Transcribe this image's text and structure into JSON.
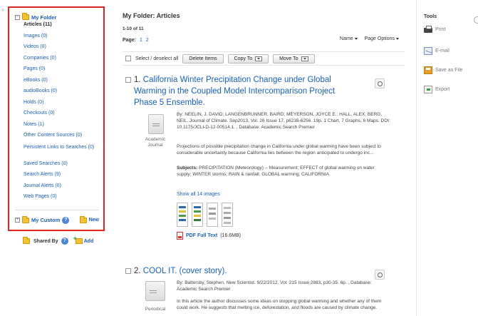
{
  "sidebar": {
    "folder_title": "My Folder",
    "items": [
      {
        "label": "Articles (11)",
        "active": true
      },
      {
        "label": "Images (0)"
      },
      {
        "label": "Videos (0)"
      },
      {
        "label": "Companies (0)"
      },
      {
        "label": "Pages (0)"
      },
      {
        "label": "eBooks (0)"
      },
      {
        "label": "audioBooks (0)"
      },
      {
        "label": "Holds (0)"
      },
      {
        "label": "Checkouts (0)"
      },
      {
        "label": "Notes (1)"
      },
      {
        "label": "Other Content Sources (0)"
      },
      {
        "label": "Persistent Links to Searches (0)"
      },
      {
        "label": "Saved Searches (0)"
      },
      {
        "label": "Search Alerts (9)"
      },
      {
        "label": "Journal Alerts (0)"
      },
      {
        "label": "Web Pages (0)"
      }
    ],
    "my_custom_label": "My Custom",
    "new_label": "New",
    "shared_by_label": "Shared By",
    "add_label": "Add"
  },
  "main": {
    "title": "My Folder: Articles",
    "range": "1-10 of 11",
    "page_label": "Page:",
    "pages": [
      "1",
      "2"
    ],
    "sort_label": "Name",
    "page_options_label": "Page Options",
    "select_all_label": "Select / deselect all",
    "delete_label": "Delete Items",
    "copy_label": "Copy To",
    "move_label": "Move To"
  },
  "records": [
    {
      "number": "1.",
      "title": "California Winter Precipitation Change under Global Warming in the Coupled Model Intercomparison Project Phase 5 Ensemble.",
      "byline": "By: NEELIN, J. DAVID; LANGENBRUNNER, BAIRD; MEYERSON, JOYCE E.; HALL, ALEX; BERG, NEIL. Journal of Climate. Sep2013, Vol. 26 Issue 17, p6238-6256. 19p. 1 Chart, 7 Graphs, 6 Maps. DOI: 10.1175/JCLI-D-12-00514.1. , Database: Academic Search Premier",
      "abstract": "Projections of possible precipitation change in California under global warming have been subject to considerable uncertainty because California lies between the region anticipated to undergo inc...",
      "subjects_label": "Subjects:",
      "subjects": "PRECIPITATION (Meteorology) -- Measurement; EFFECT of global warming on water supply; WINTER storms; RAIN & rainfall; GLOBAL warming; CALIFORNIA",
      "doc_type": "Academic Journal",
      "show_images": "Show all 14 images",
      "pdf_label": "PDF Full Text",
      "pdf_size": "(16.6MB)"
    },
    {
      "number": "2.",
      "title": "COOL IT. (cover story).",
      "byline": "By: Battersby, Stephen. New Scientist. 9/22/2012, Vol. 215 Issue 2883, p30-35. 6p. , Database: Academic Search Premier",
      "abstract": "In this article the author discusses some ideas on stopping global warming and whether any of them could work. He suggests that melting ice, deforestation, and floods are caused by climate change.",
      "doc_type": "Periodical"
    }
  ],
  "tools": {
    "title": "Tools",
    "items": [
      {
        "label": "Print",
        "icon": "printer-icon"
      },
      {
        "label": "E-mail",
        "icon": "email-icon"
      },
      {
        "label": "Save as File",
        "icon": "save-icon"
      },
      {
        "label": "Export",
        "icon": "export-icon"
      }
    ]
  },
  "colors": {
    "highlight_border": "#e02424",
    "link": "#1a5fb4"
  }
}
